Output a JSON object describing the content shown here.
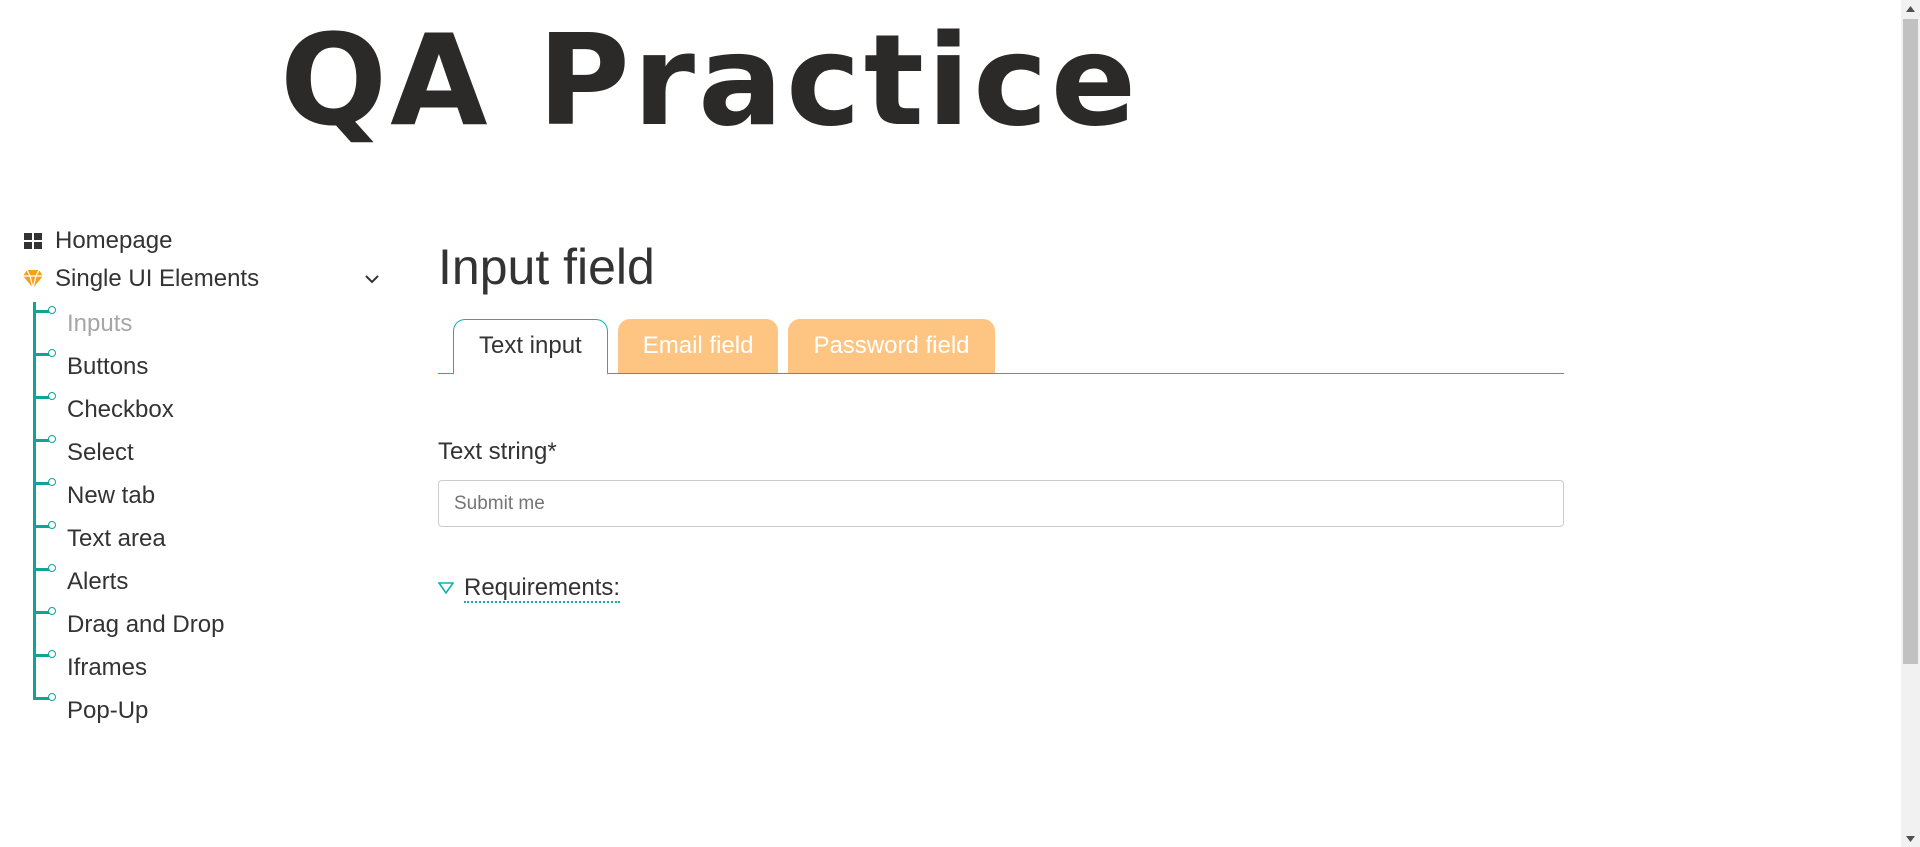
{
  "header": {
    "logo_text": "QA Practice"
  },
  "sidebar": {
    "homepage_label": "Homepage",
    "section_label": "Single UI Elements",
    "items": [
      {
        "label": "Inputs",
        "active": true
      },
      {
        "label": "Buttons"
      },
      {
        "label": "Checkbox"
      },
      {
        "label": "Select"
      },
      {
        "label": "New tab"
      },
      {
        "label": "Text area"
      },
      {
        "label": "Alerts"
      },
      {
        "label": "Drag and Drop"
      },
      {
        "label": "Iframes"
      },
      {
        "label": "Pop-Up"
      }
    ]
  },
  "main": {
    "title": "Input field",
    "tabs": [
      {
        "label": "Text input",
        "active": true
      },
      {
        "label": "Email field"
      },
      {
        "label": "Password field"
      }
    ],
    "field_label": "Text string*",
    "input": {
      "value": "",
      "placeholder": "Submit me"
    },
    "requirements_label": "Requirements:"
  },
  "colors": {
    "accent_teal": "#11b4ad",
    "tab_inactive_bg": "#fdc581",
    "icon_orange": "#f4a21b",
    "text": "#333333"
  },
  "icons": {
    "homepage": "grid-icon",
    "section": "gem-icon",
    "expand": "chevron-down-icon",
    "requirements": "triangle-down-icon"
  }
}
